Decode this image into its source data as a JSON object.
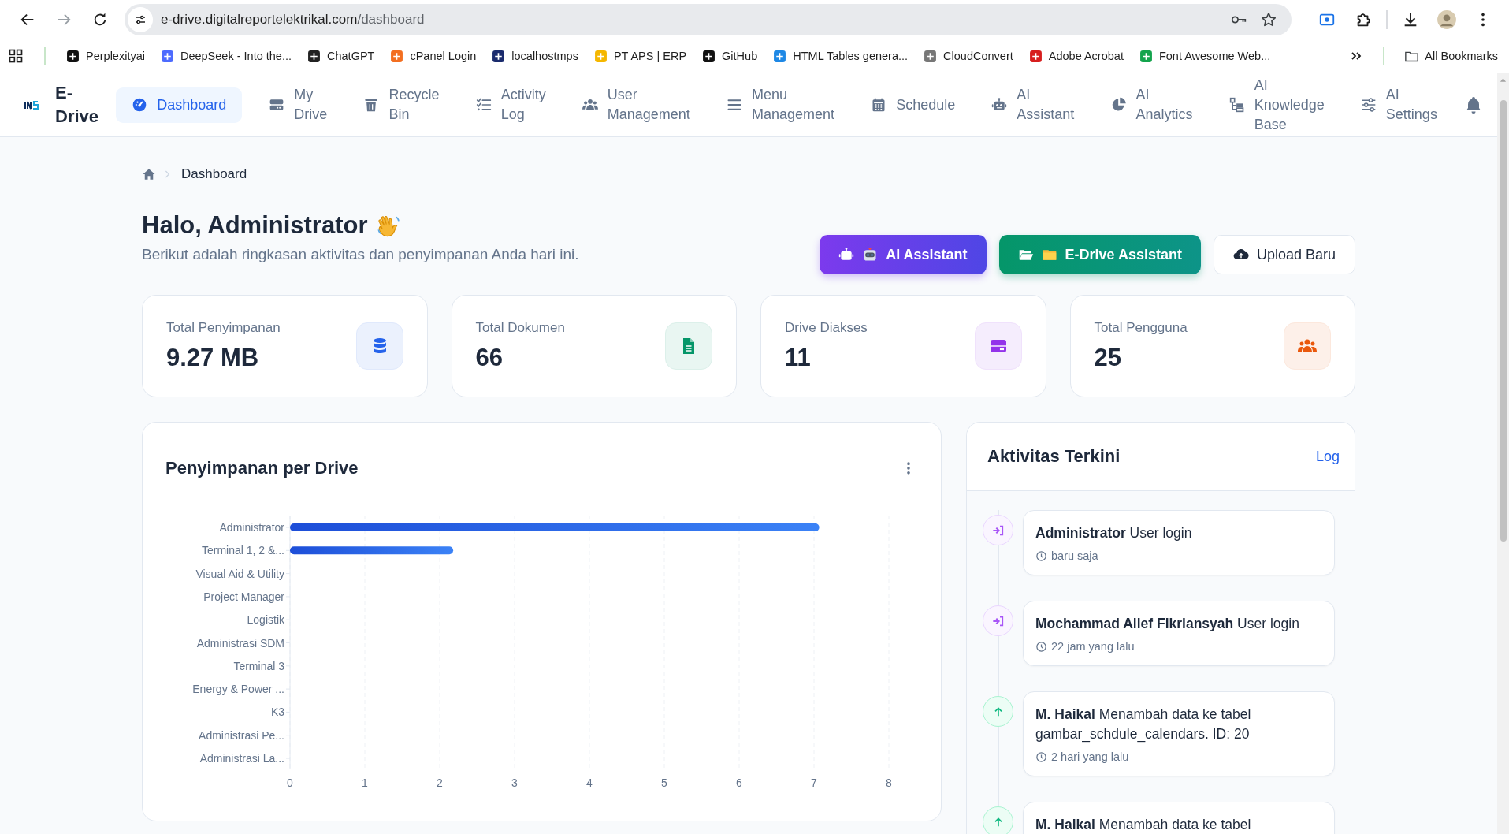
{
  "browser": {
    "url_host": "e-drive.digitalreportelektrikal.com",
    "url_path": "/dashboard",
    "bookmarks": [
      {
        "label": "Perplexityai"
      },
      {
        "label": "DeepSeek - Into the..."
      },
      {
        "label": "ChatGPT"
      },
      {
        "label": "cPanel Login"
      },
      {
        "label": "localhostmps"
      },
      {
        "label": "PT APS | ERP"
      },
      {
        "label": "GitHub"
      },
      {
        "label": "HTML Tables genera..."
      },
      {
        "label": "CloudConvert"
      },
      {
        "label": "Adobe Acrobat"
      },
      {
        "label": "Font Awesome Web..."
      }
    ],
    "all_bookmarks": "All Bookmarks"
  },
  "nav": {
    "brand": "E-Drive",
    "items": [
      {
        "label": "Dashboard",
        "selected": true
      },
      {
        "label": "My Drive",
        "selected": false
      },
      {
        "label": "Recycle Bin",
        "selected": false
      },
      {
        "label": "Activity Log",
        "selected": false
      },
      {
        "label": "User Management",
        "selected": false
      },
      {
        "label": "Menu Management",
        "selected": false
      },
      {
        "label": "Schedule",
        "selected": false
      },
      {
        "label": "AI Assistant",
        "selected": false
      },
      {
        "label": "AI Analytics",
        "selected": false
      },
      {
        "label": "AI Knowledge Base",
        "selected": false
      },
      {
        "label": "AI Settings",
        "selected": false
      }
    ]
  },
  "breadcrumb": {
    "current": "Dashboard"
  },
  "greeting": {
    "title": "Halo, Administrator",
    "subtitle": "Berikut adalah ringkasan aktivitas dan penyimpanan Anda hari ini."
  },
  "actions": [
    {
      "label": "AI Assistant",
      "kind": "ai"
    },
    {
      "label": "E-Drive Assistant",
      "kind": "drive"
    },
    {
      "label": "Upload Baru",
      "kind": "upload"
    }
  ],
  "stats": [
    {
      "label": "Total Penyimpanan",
      "value": "9.27 MB",
      "color": "#2563eb"
    },
    {
      "label": "Total Dokumen",
      "value": "66",
      "color": "#059669"
    },
    {
      "label": "Drive Diakses",
      "value": "11",
      "color": "#9333ea"
    },
    {
      "label": "Total Pengguna",
      "value": "25",
      "color": "#ea580c"
    }
  ],
  "storage_chart": {
    "title": "Penyimpanan per Drive",
    "chart_data": {
      "type": "bar",
      "orientation": "horizontal",
      "categories": [
        "Administrator",
        "Terminal 1, 2 &...",
        "Visual Aid & Utility",
        "Project Manager",
        "Logistik",
        "Administrasi SDM",
        "Terminal 3",
        "Energy & Power ...",
        "K3",
        "Administrasi Pe...",
        "Administrasi La..."
      ],
      "values": [
        7.07,
        2.18,
        0,
        0,
        0,
        0,
        0,
        0,
        0,
        0,
        0
      ],
      "xlim": [
        0,
        8
      ],
      "xticks": [
        0,
        1,
        2,
        3,
        4,
        5,
        6,
        7,
        8
      ],
      "grid": true
    }
  },
  "activity": {
    "title": "Aktivitas Terkini",
    "link": "Log",
    "items": [
      {
        "kind": "login",
        "text": "**Administrator** User login",
        "time": "baru saja"
      },
      {
        "kind": "login",
        "text": "**Mochammad Alief Fikriansyah** User login",
        "time": "22 jam yang lalu"
      },
      {
        "kind": "create",
        "text": "**M. Haikal** Menambah data ke tabel gambar_schdule_calendars. ID: 20",
        "time": "2 hari yang lalu"
      },
      {
        "kind": "create",
        "text": "**M. Haikal** Menambah data ke tabel"
      }
    ]
  }
}
